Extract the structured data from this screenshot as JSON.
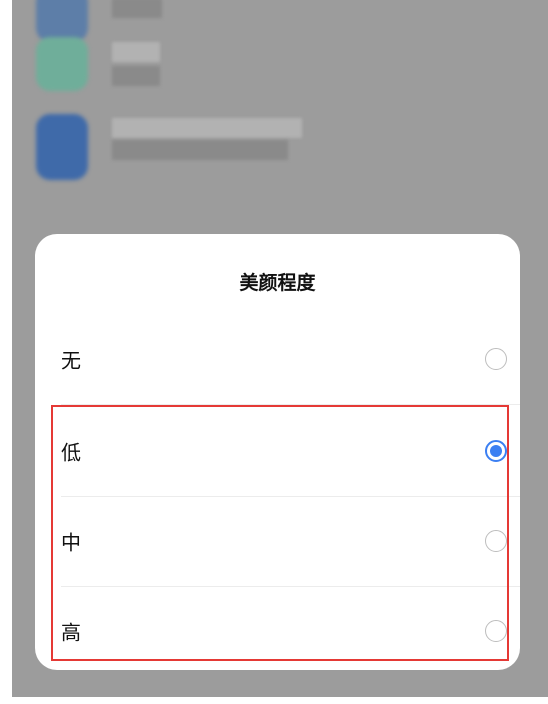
{
  "dialog": {
    "title": "美颜程度",
    "options": [
      {
        "label": "无",
        "selected": false
      },
      {
        "label": "低",
        "selected": true
      },
      {
        "label": "中",
        "selected": false
      },
      {
        "label": "高",
        "selected": false
      }
    ]
  },
  "colors": {
    "accent": "#3b7ff2",
    "highlight_border": "#e53935",
    "overlay": "#9c9c9c"
  }
}
